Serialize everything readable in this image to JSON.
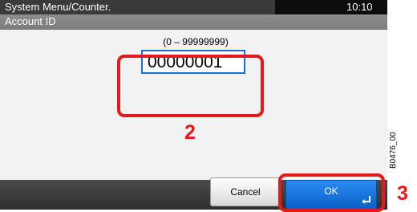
{
  "status_bar": {
    "title": "System Menu/Counter.",
    "time": "10:10"
  },
  "header": {
    "title": "Account ID"
  },
  "id_entry": {
    "range_label": "(0 – 99999999)",
    "value": "00000001"
  },
  "buttons": {
    "cancel_label": "Cancel",
    "ok_label": "OK"
  },
  "callouts": {
    "step_2": "2",
    "step_3": "3"
  },
  "figure_ref": "B0476_00",
  "icons": {
    "enter": "enter-return-icon"
  },
  "colors": {
    "accent": "#1a6fd0",
    "callout": "#e51a1a",
    "ok_button": "#1a73e0"
  }
}
